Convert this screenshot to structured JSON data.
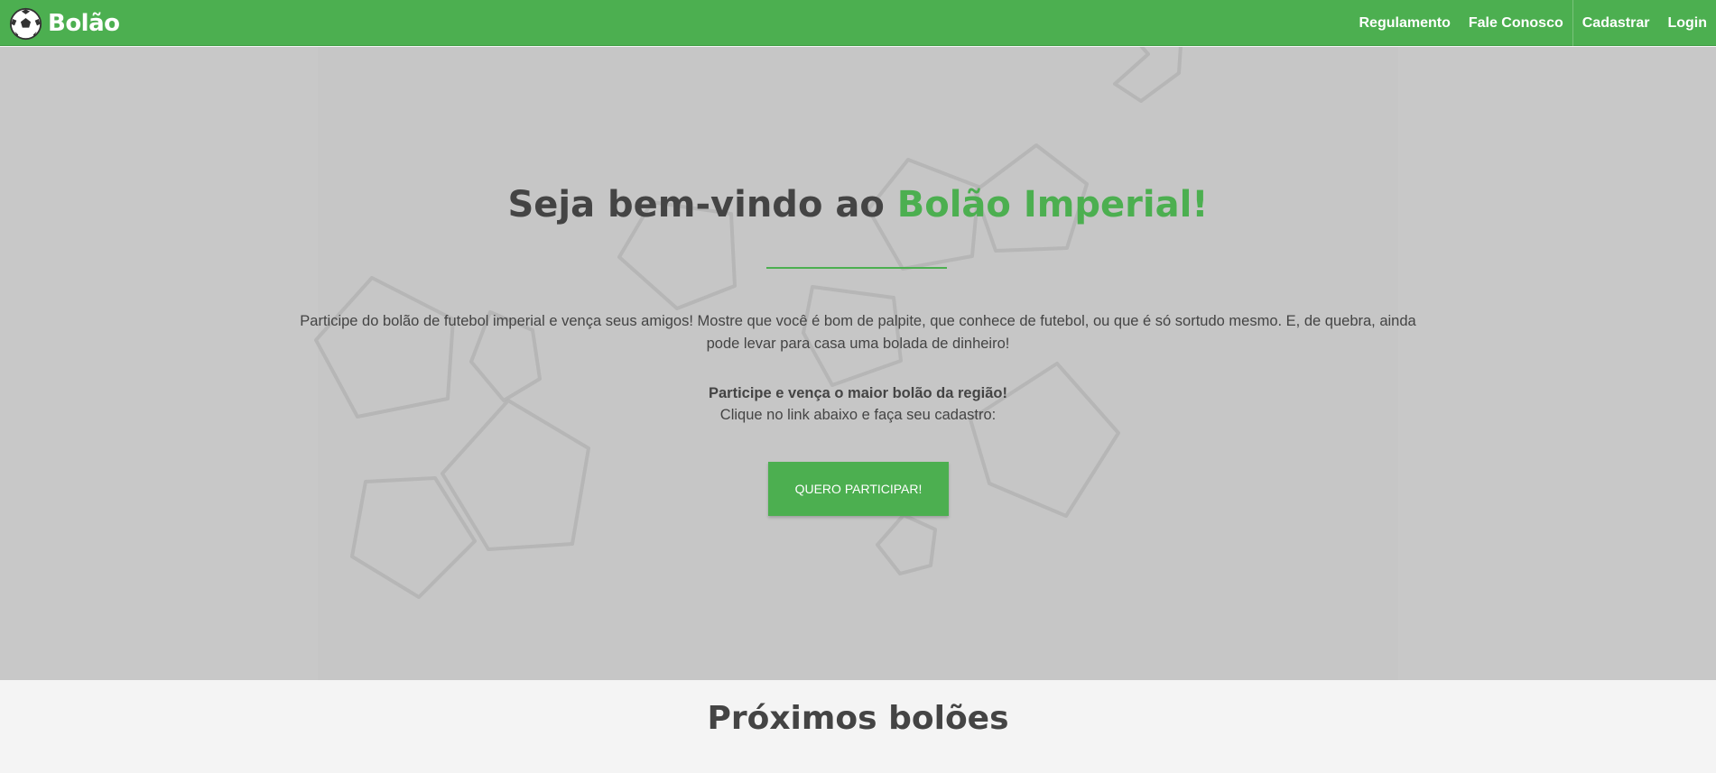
{
  "brand": {
    "name": "Bolão",
    "logo_icon": "soccer-ball-icon"
  },
  "nav": {
    "items": [
      "Regulamento",
      "Fale Conosco",
      "Cadastrar",
      "Login"
    ]
  },
  "hero": {
    "title_prefix": "Seja bem-vindo ao ",
    "title_accent": "Bolão Imperial!",
    "description": "Participe do bolão de futebol imperial e vença seus amigos! Mostre que você é bom de palpite, que conhece de futebol, ou que é só sortudo mesmo. E, de quebra, ainda pode levar para casa uma bolada de dinheiro!",
    "strong_line": "Participe e vença o maior bolão da região!",
    "sub_line": "Clique no link abaixo e faça seu cadastro:",
    "cta_label": "QUERO PARTICIPAR!"
  },
  "section": {
    "title": "Próximos bolões"
  },
  "colors": {
    "accent": "#4caf50",
    "hero_bg": "#c8c8c8",
    "text": "#444444",
    "page_bg": "#f4f4f4"
  }
}
